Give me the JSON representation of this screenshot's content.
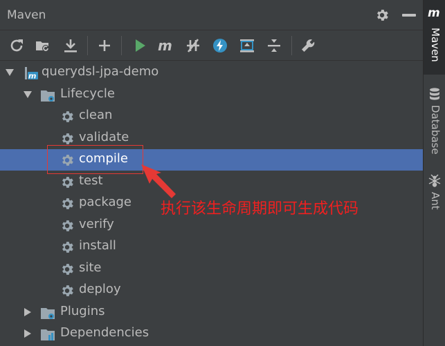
{
  "panel": {
    "title": "Maven"
  },
  "toolbar": {
    "buttons": [
      {
        "name": "reimport-icon"
      },
      {
        "name": "generate-sources-icon"
      },
      {
        "name": "download-icon"
      },
      {
        "name": "add-icon"
      },
      {
        "name": "run-icon"
      },
      {
        "name": "execute-goal-icon"
      },
      {
        "name": "skip-tests-icon"
      },
      {
        "name": "offline-icon"
      },
      {
        "name": "show-dependencies-icon"
      },
      {
        "name": "collapse-all-icon"
      },
      {
        "name": "settings-wrench-icon"
      }
    ]
  },
  "tree": {
    "project": "querydsl-jpa-demo",
    "lifecycle": "Lifecycle",
    "goals": [
      "clean",
      "validate",
      "compile",
      "test",
      "package",
      "verify",
      "install",
      "site",
      "deploy"
    ],
    "selected_goal": "compile",
    "plugins": "Plugins",
    "dependencies": "Dependencies"
  },
  "right_strip": {
    "tabs": [
      {
        "label": "Maven",
        "active": true
      },
      {
        "label": "Database",
        "active": false
      },
      {
        "label": "Ant",
        "active": false
      }
    ]
  },
  "annotation": {
    "text": "执行该生命周期即可生成代码",
    "color": "#f02020"
  },
  "colors": {
    "background": "#3c3f41",
    "selection": "#4b6eaf",
    "run_green": "#59a869",
    "accent_blue": "#3592c4"
  }
}
